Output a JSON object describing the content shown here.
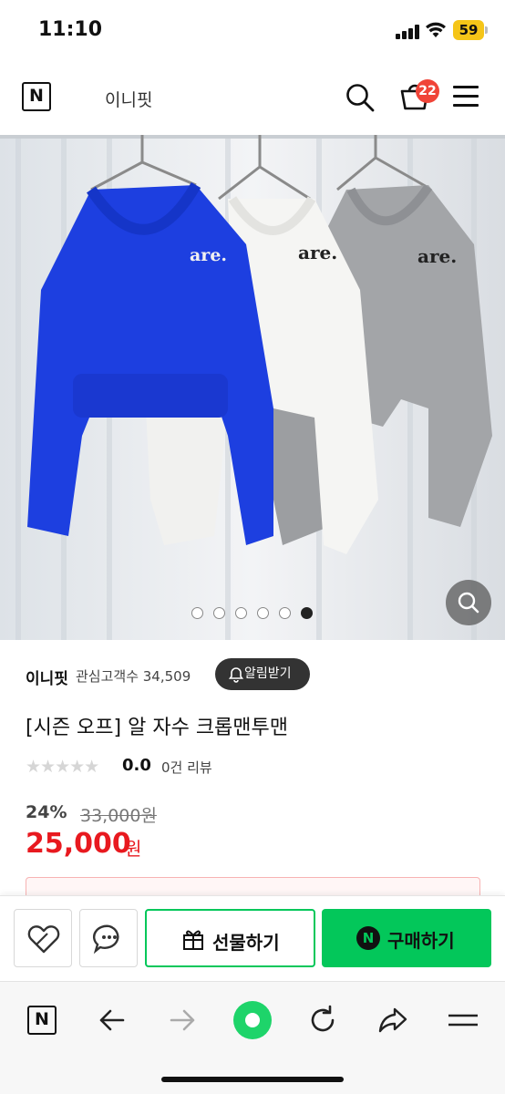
{
  "status_bar": {
    "time": "11:10",
    "battery": "59"
  },
  "header": {
    "logo_letter": "N",
    "shop_name": "이니핏",
    "cart_count": "22"
  },
  "store": {
    "name": "이니핏",
    "interest_label": "관심고객수 34,509",
    "alarm_label": "알림받기"
  },
  "product": {
    "title": "[시즌 오프] 알 자수 크롭맨투맨",
    "rating": "0.0",
    "review_label": "0건 리뷰",
    "stars": "★★★★★",
    "discount": "24%",
    "original_price": "33,000원",
    "price": "25,000",
    "price_unit": "원",
    "sweatshirt_print": "are."
  },
  "gallery": {
    "image_count": 6,
    "active_index": 5
  },
  "actions": {
    "gift_label": "선물하기",
    "buy_label": "구매하기",
    "buy_logo": "N"
  },
  "browser_nav": {
    "home_logo": "N"
  },
  "colors": {
    "naver_green": "#03c75a",
    "price_red": "#e8191f",
    "badge_red": "#f04438"
  }
}
